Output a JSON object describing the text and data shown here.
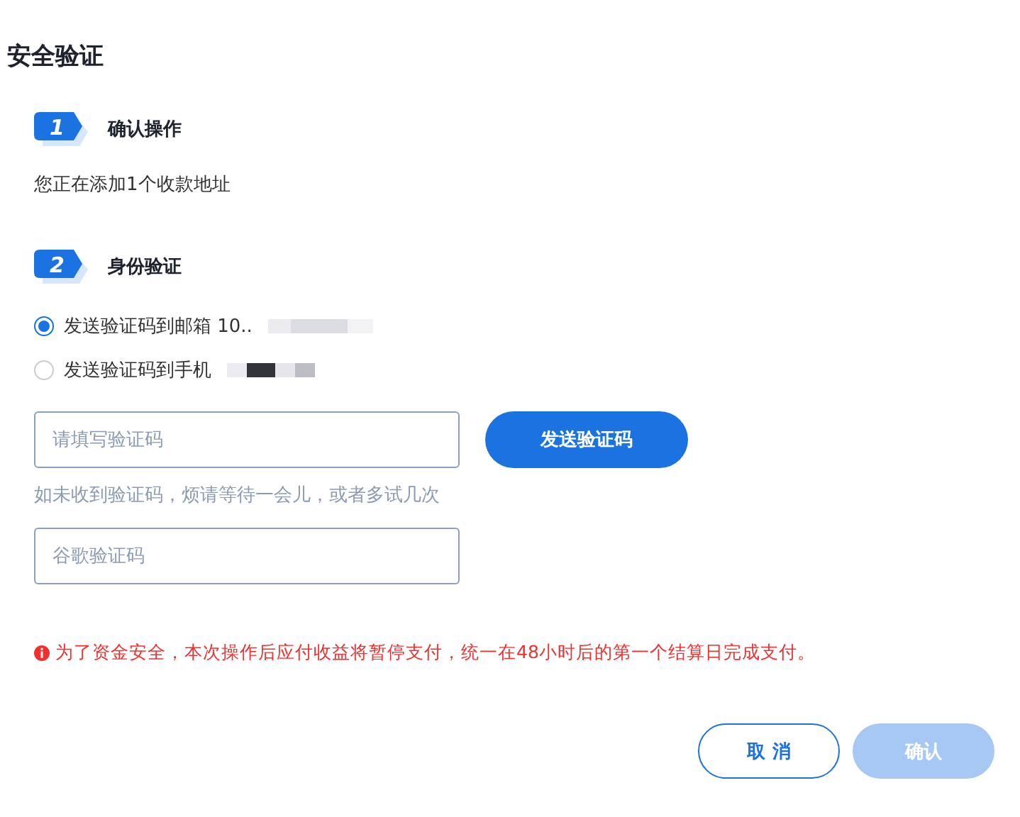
{
  "title": "安全验证",
  "steps": [
    {
      "number": "1",
      "title": "确认操作"
    },
    {
      "number": "2",
      "title": "身份验证"
    }
  ],
  "operation_text": "您正在添加1个收款地址",
  "options": [
    {
      "label": "发送验证码到邮箱 10..",
      "selected": true
    },
    {
      "label": "发送验证码到手机",
      "selected": false
    }
  ],
  "code_field": {
    "placeholder": "请填写验证码"
  },
  "send_button": "发送验证码",
  "hint": "如未收到验证码，烦请等待一会儿，或者多试几次",
  "google_field": {
    "placeholder": "谷歌验证码"
  },
  "warning": "为了资金安全，本次操作后应付收益将暂停支付，统一在48小时后的第一个结算日完成支付。",
  "buttons": [
    {
      "label": "取 消",
      "kind": "secondary",
      "disabled": false
    },
    {
      "label": "确认",
      "kind": "primary",
      "disabled": true
    }
  ]
}
